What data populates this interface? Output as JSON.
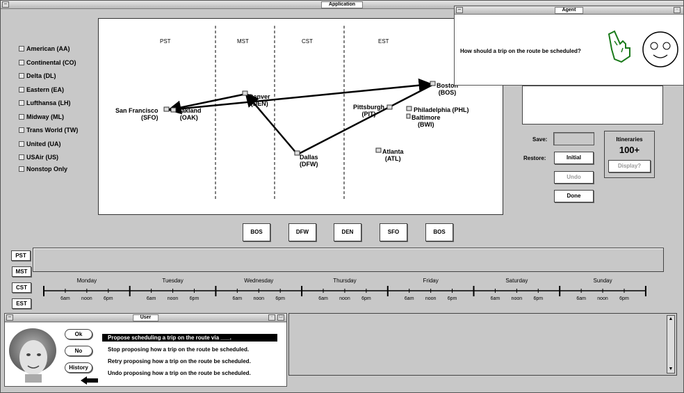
{
  "app_window": {
    "title": "Application"
  },
  "airlines": [
    "American (AA)",
    "Continental (CO)",
    "Delta (DL)",
    "Eastern (EA)",
    "Lufthansa (LH)",
    "Midway (ML)",
    "Trans World (TW)",
    "United (UA)",
    "USAir (US)"
  ],
  "nonstop_label": "Nonstop Only",
  "timezones_header": [
    "PST",
    "MST",
    "CST",
    "EST"
  ],
  "cities": {
    "sfo": "San Francisco\n(SFO)",
    "oak": "Oakland\n(OAK)",
    "den": "Denver\n(DEN)",
    "dfw": "Dallas\n(DFW)",
    "pit": "Pittsburgh\n(PIT)",
    "phl": "Philadelphia (PHL)",
    "bwi": "Baltimore\n(BWI)",
    "atl": "Atlanta\n(ATL)",
    "bos": "Boston\n(BOS)"
  },
  "route_buttons": [
    "BOS",
    "DFW",
    "DEN",
    "SFO",
    "BOS"
  ],
  "controls": {
    "save_label": "Save:",
    "restore_label": "Restore:",
    "initial": "Initial",
    "undo": "Undo",
    "done": "Done"
  },
  "itineraries": {
    "title": "Itineraries",
    "count": "100+",
    "display": "Display?"
  },
  "timezone_buttons": [
    "PST",
    "MST",
    "CST",
    "EST"
  ],
  "days": [
    "Monday",
    "Tuesday",
    "Wednesday",
    "Thursday",
    "Friday",
    "Saturday",
    "Sunday"
  ],
  "hour_labels": [
    "6am",
    "noon",
    "6pm"
  ],
  "agent_window": {
    "title": "Agent",
    "message": "How should a trip on the route be scheduled?"
  },
  "user_window": {
    "title": "User",
    "buttons": {
      "ok": "Ok",
      "no": "No",
      "history": "History"
    },
    "options": [
      "Propose scheduling a trip on the route via ___.",
      "Stop proposing how a trip on the route be scheduled.",
      "Retry proposing how a trip on the route be scheduled.",
      "Undo proposing how a trip on the route be scheduled."
    ]
  },
  "colors": {
    "window_bg": "#c8c8c8",
    "selection": "#000000"
  }
}
